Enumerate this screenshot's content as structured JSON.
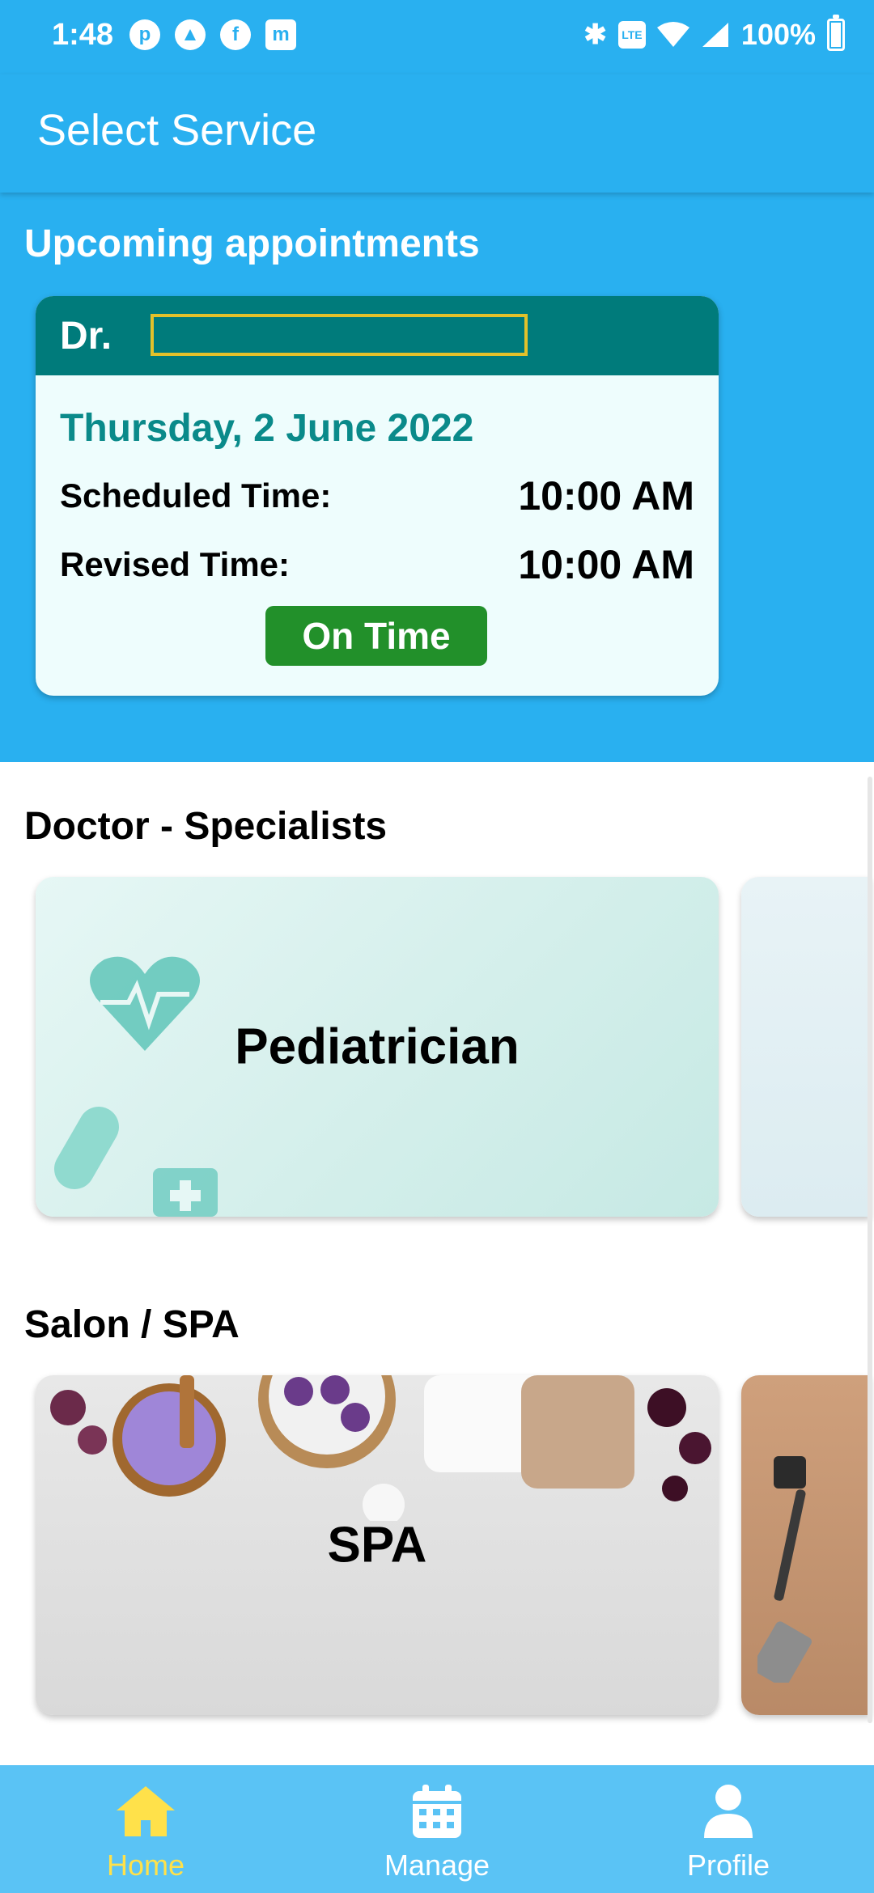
{
  "status_bar": {
    "time": "1:48",
    "battery": "100%",
    "battery_level": 1.0
  },
  "app_bar": {
    "title": "Select Service"
  },
  "upcoming": {
    "title": "Upcoming appointments",
    "card": {
      "doctor_prefix": "Dr.",
      "doctor_name": "",
      "date": "Thursday, 2 June 2022",
      "scheduled_label": "Scheduled Time:",
      "scheduled_value": "10:00 AM",
      "revised_label": "Revised Time:",
      "revised_value": "10:00 AM",
      "status": "On Time",
      "status_color": "#22902a",
      "header_color": "#007b7b"
    }
  },
  "sections": {
    "doctor": {
      "title": "Doctor - Specialists",
      "cards": [
        {
          "label": "Pediatrician"
        }
      ]
    },
    "salon": {
      "title": "Salon / SPA",
      "cards": [
        {
          "label": "SPA"
        }
      ]
    }
  },
  "bottom_nav": {
    "items": [
      {
        "label": "Home",
        "icon": "home-icon",
        "active": true
      },
      {
        "label": "Manage",
        "icon": "calendar-icon",
        "active": false
      },
      {
        "label": "Profile",
        "icon": "person-icon",
        "active": false
      }
    ],
    "active_color": "#ffe14a"
  },
  "colors": {
    "primary": "#29b0f0",
    "nav_background": "#5ac3f5"
  }
}
